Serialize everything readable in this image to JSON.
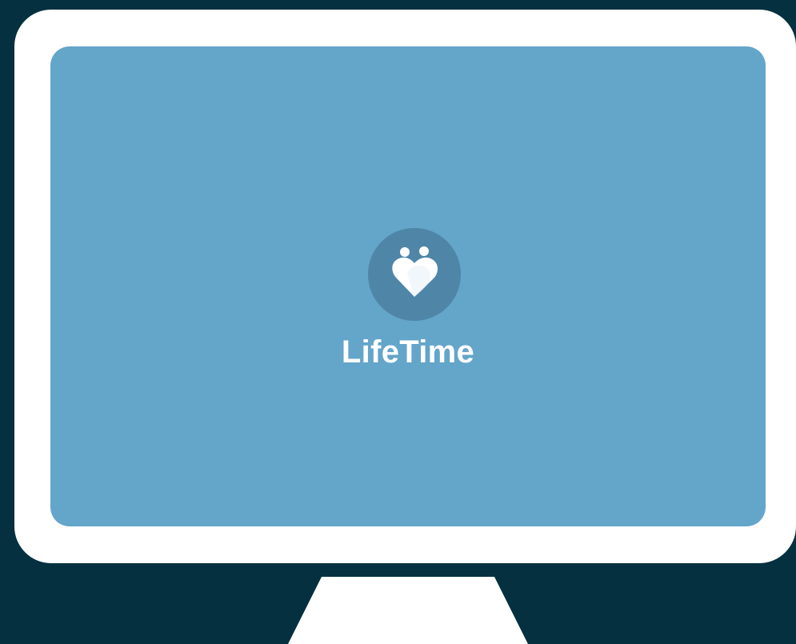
{
  "brand": {
    "name": "LifeTime",
    "icon": "heart-with-two-people-icon"
  },
  "colors": {
    "background": "#04303f",
    "bezel": "#ffffff",
    "screen": "#64a5ca",
    "logo_circle": "#4f86a8",
    "logo_mark": "#ffffff",
    "text": "#ffffff"
  }
}
